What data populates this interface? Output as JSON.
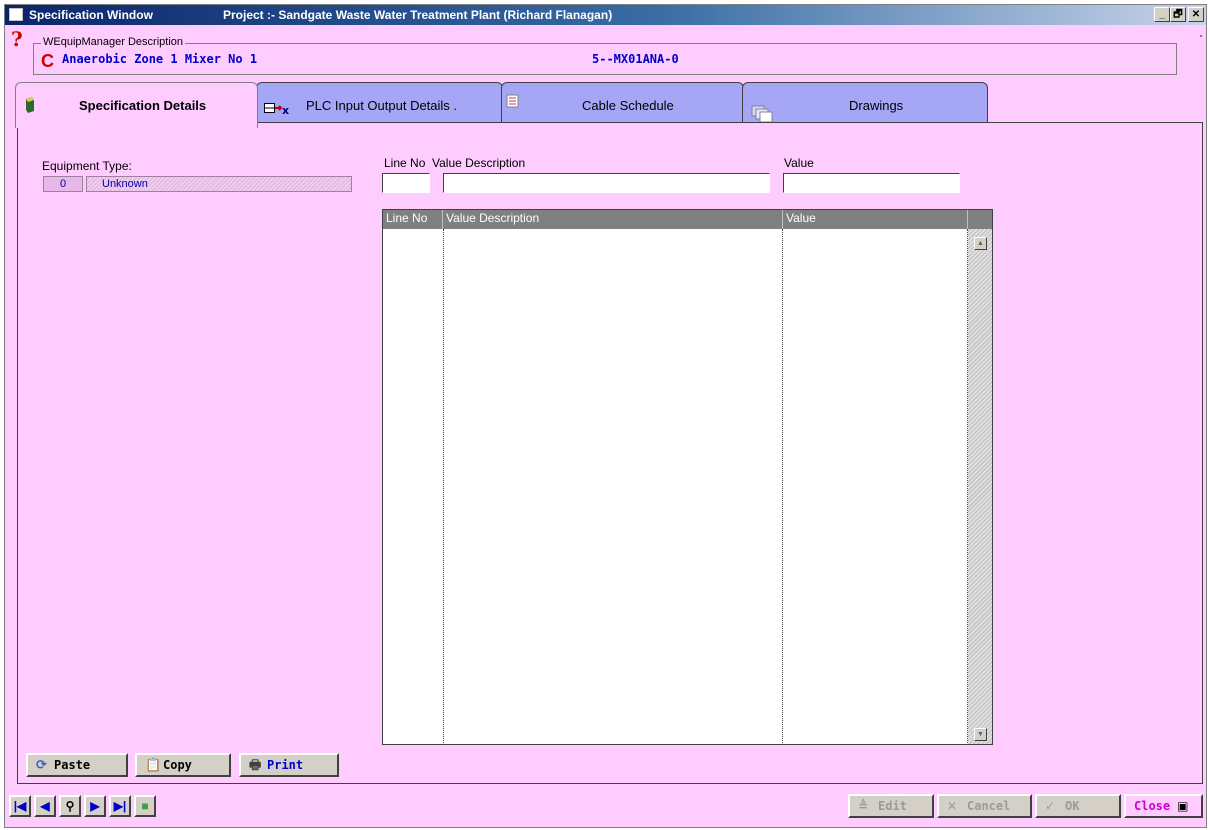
{
  "window": {
    "title": "Specification Window",
    "project": "Project :- Sandgate Waste Water Treatment Plant (Richard Flanagan)",
    "buttons": {
      "minimize": "_",
      "restore": "🗗",
      "close": "✕"
    }
  },
  "description": {
    "group_label": "WEquipManager Description",
    "name": "Anaerobic Zone 1 Mixer No 1",
    "code": "5--MX01ANA-0"
  },
  "tabs": [
    {
      "label": "Specification Details",
      "icon": "book-icon",
      "active": true
    },
    {
      "label": "PLC Input Output Details  .",
      "icon": "io-transfer-icon",
      "active": false
    },
    {
      "label": "Cable Schedule",
      "icon": "cable-list-icon",
      "active": false
    },
    {
      "label": "Drawings",
      "icon": "drawings-stack-icon",
      "active": false
    }
  ],
  "specification": {
    "equipment_type_label": "Equipment Type:",
    "equipment_type_code": "0",
    "equipment_type_name": "Unknown",
    "entry_labels": {
      "line_no": "Line No",
      "value_description": "Value Description",
      "value": "Value"
    },
    "entry_values": {
      "line_no": "",
      "value_description": "",
      "value": ""
    },
    "grid_columns": [
      "Line No",
      "Value Description",
      "Value"
    ],
    "grid_rows": []
  },
  "footer_buttons": {
    "paste": "Paste",
    "copy": "Copy",
    "print": "Print"
  },
  "navigation": {
    "first": "first-record-icon",
    "prev": "previous-record-icon",
    "find": "binoculars-icon",
    "next": "next-record-icon",
    "last": "last-record-icon",
    "refresh": "refresh-icon"
  },
  "actions": {
    "edit": "Edit",
    "cancel": "Cancel",
    "ok": "OK",
    "close": "Close"
  },
  "colors": {
    "background": "#ffccff",
    "inactive_tab": "#a6a6f6",
    "accent_text": "#0000cc",
    "close_text": "#cc00cc"
  }
}
